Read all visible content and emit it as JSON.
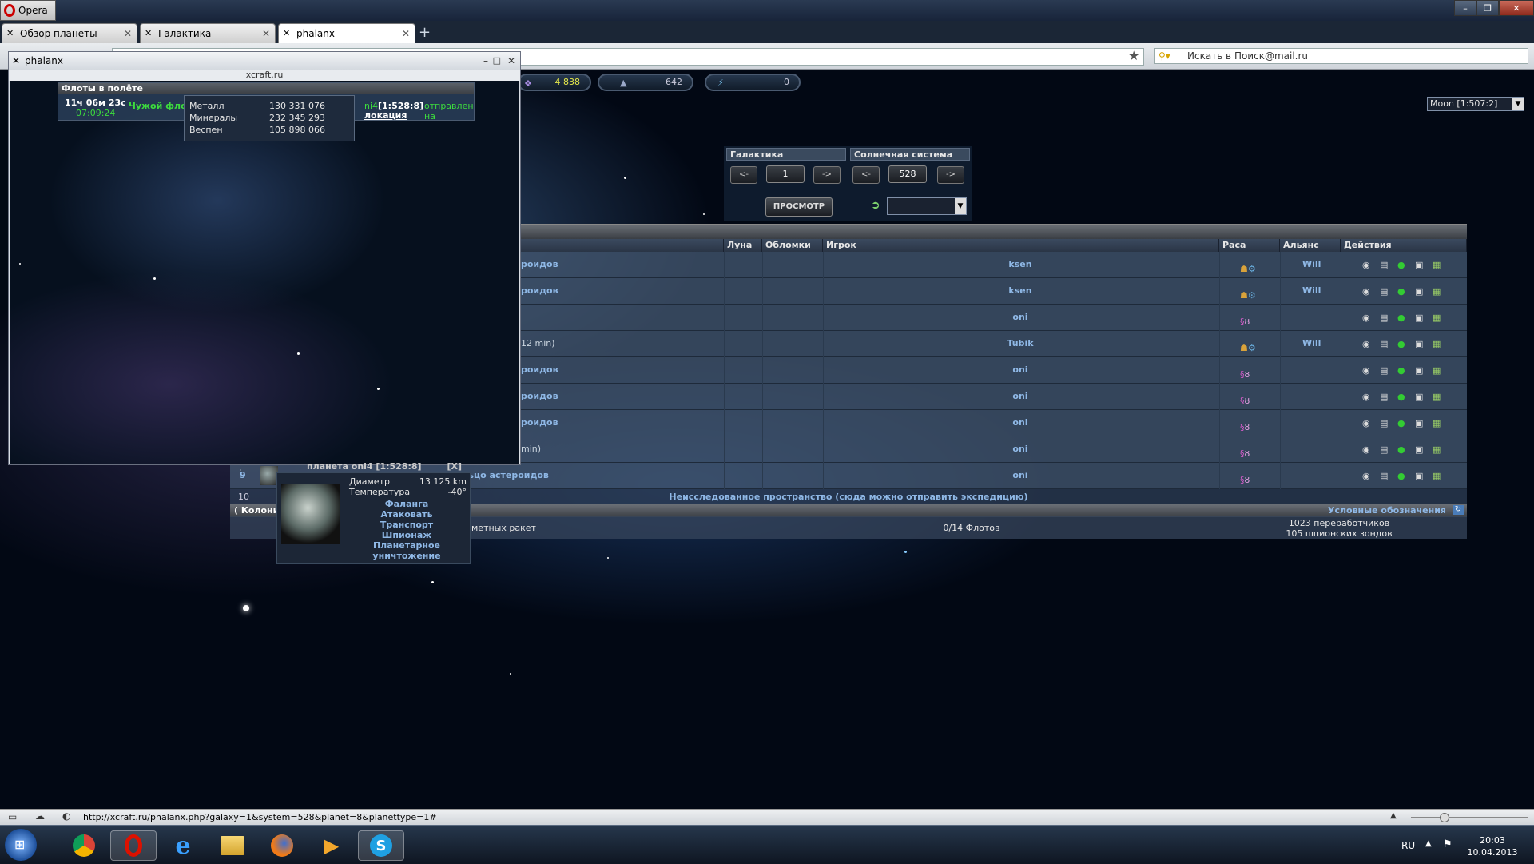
{
  "browser": {
    "menu_label": "Opera",
    "tabs": [
      {
        "label": "Обзор планеты",
        "active": false
      },
      {
        "label": "Галактика",
        "active": false
      },
      {
        "label": "phalanx",
        "active": true
      }
    ],
    "new_tab": "+",
    "search_placeholder": "Искать в Поиск@mail.ru",
    "status_url": "http://xcraft.ru/phalanx.php?galaxy=1&system=528&planet=8&planettype=1#"
  },
  "resources": [
    {
      "icon": "crystal-icon",
      "value": "4 838",
      "color": "#e3e64a"
    },
    {
      "icon": "deuterium-icon",
      "value": "642",
      "color": "#cfd8e4"
    },
    {
      "icon": "energy-icon",
      "value": "0",
      "color": "#cfd8e4"
    }
  ],
  "moon_select": {
    "value": "Moon [1:507:2]"
  },
  "galaxy_nav": {
    "galaxy_label": "Галактика",
    "system_label": "Солнечная система",
    "prev": "<-",
    "next": "->",
    "galaxy_value": "1",
    "system_value": "528",
    "view_button": "ПРОСМОТР"
  },
  "table": {
    "headers": {
      "moon": "Луна",
      "debris": "Обломки",
      "player": "Игрок",
      "race": "Раса",
      "alliance": "Альянс",
      "actions": "Действия"
    },
    "rows": [
      {
        "name": "роидов",
        "player": "ksen",
        "alliance": "Will",
        "race": "human"
      },
      {
        "name": "роидов",
        "player": "ksen",
        "alliance": "Will",
        "race": "human"
      },
      {
        "name": "",
        "player": "oni",
        "alliance": "",
        "race": "alien"
      },
      {
        "name": "12 min)",
        "player": "Tubik",
        "alliance": "Will",
        "race": "human"
      },
      {
        "name": "роидов",
        "player": "oni",
        "alliance": "",
        "race": "alien"
      },
      {
        "name": "роидов",
        "player": "oni",
        "alliance": "",
        "race": "alien"
      },
      {
        "name": "роидов",
        "player": "oni",
        "alliance": "",
        "race": "alien"
      },
      {
        "name": "min)",
        "player": "oni",
        "alliance": "",
        "race": "alien"
      },
      {
        "name": "льцо астероидов",
        "player": "oni",
        "alliance": "",
        "race": "alien",
        "num": "9"
      }
    ],
    "row10_num": "10",
    "unexplored": "Неисследованное пространство (сюда можно отправить экспедицию)",
    "colonized": "( Колониз",
    "legend_label": "Условные обозначения",
    "missiles": "метных ракет",
    "fleets": "0/14 Флотов",
    "recyclers": "1023 переработчиков",
    "probes": "105 шпионских зондов"
  },
  "phalanx_window": {
    "title": "phalanx",
    "url": "xcraft.ru",
    "fleets_header": "Флоты в полёте",
    "time": "11ч 06м 23с",
    "countdown": "07:09:24",
    "fleet_label": "Чужой флот",
    "dest_prefix": "ni4",
    "dest_coords": "[1:528:8]",
    "sent_to": "отправлен на",
    "mission": "локация",
    "cargo": [
      {
        "label": "Металл",
        "value": "130 331 076"
      },
      {
        "label": "Минералы",
        "value": "232 345 293"
      },
      {
        "label": "Веспен",
        "value": "105 898 066"
      }
    ]
  },
  "planet_popup": {
    "header": "планета oni4 [1:528:8]",
    "close": "[X]",
    "diameter_label": "Диаметр",
    "diameter_value": "13 125 km",
    "temp_label": "Температура",
    "temp_value": "-40°",
    "actions": [
      "Фаланга",
      "Атаковать",
      "Транспорт",
      "Шпионаж",
      "Планетарное",
      "уничтожение"
    ]
  },
  "tray": {
    "lang": "RU",
    "time": "20:03",
    "date": "10.04.2013"
  }
}
